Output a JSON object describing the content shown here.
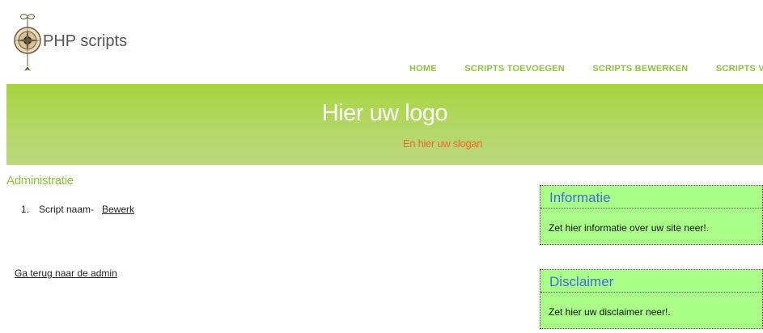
{
  "header": {
    "site_title": "PHP scripts",
    "logo_icon": "compass-rose-icon",
    "nav": [
      "HOME",
      "SCRIPTS TOEVOEGEN",
      "SCRIPTS BEWERKEN",
      "SCRIPTS VERWIJ"
    ]
  },
  "banner": {
    "title": "Hier uw logo",
    "slogan": "En hier uw slogan"
  },
  "main": {
    "title": "Administratie",
    "scripts": [
      {
        "number": "1.",
        "name": "Script naam-",
        "edit_label": "Bewerk"
      }
    ],
    "back_link": "Ga terug naar de admin"
  },
  "sidebar": {
    "info": {
      "title": "Informatie",
      "text": "Zet hier informatie over uw site neer!."
    },
    "disclaimer": {
      "title": "Disclaimer",
      "text": "Zet hier uw disclaimer neer!."
    }
  },
  "colors": {
    "accent_green": "#8cc43c",
    "banner_green": "#a6d33e",
    "slogan_orange": "#f2672a",
    "box_bg": "#aaff88",
    "box_title_blue": "#3b6fd0"
  }
}
